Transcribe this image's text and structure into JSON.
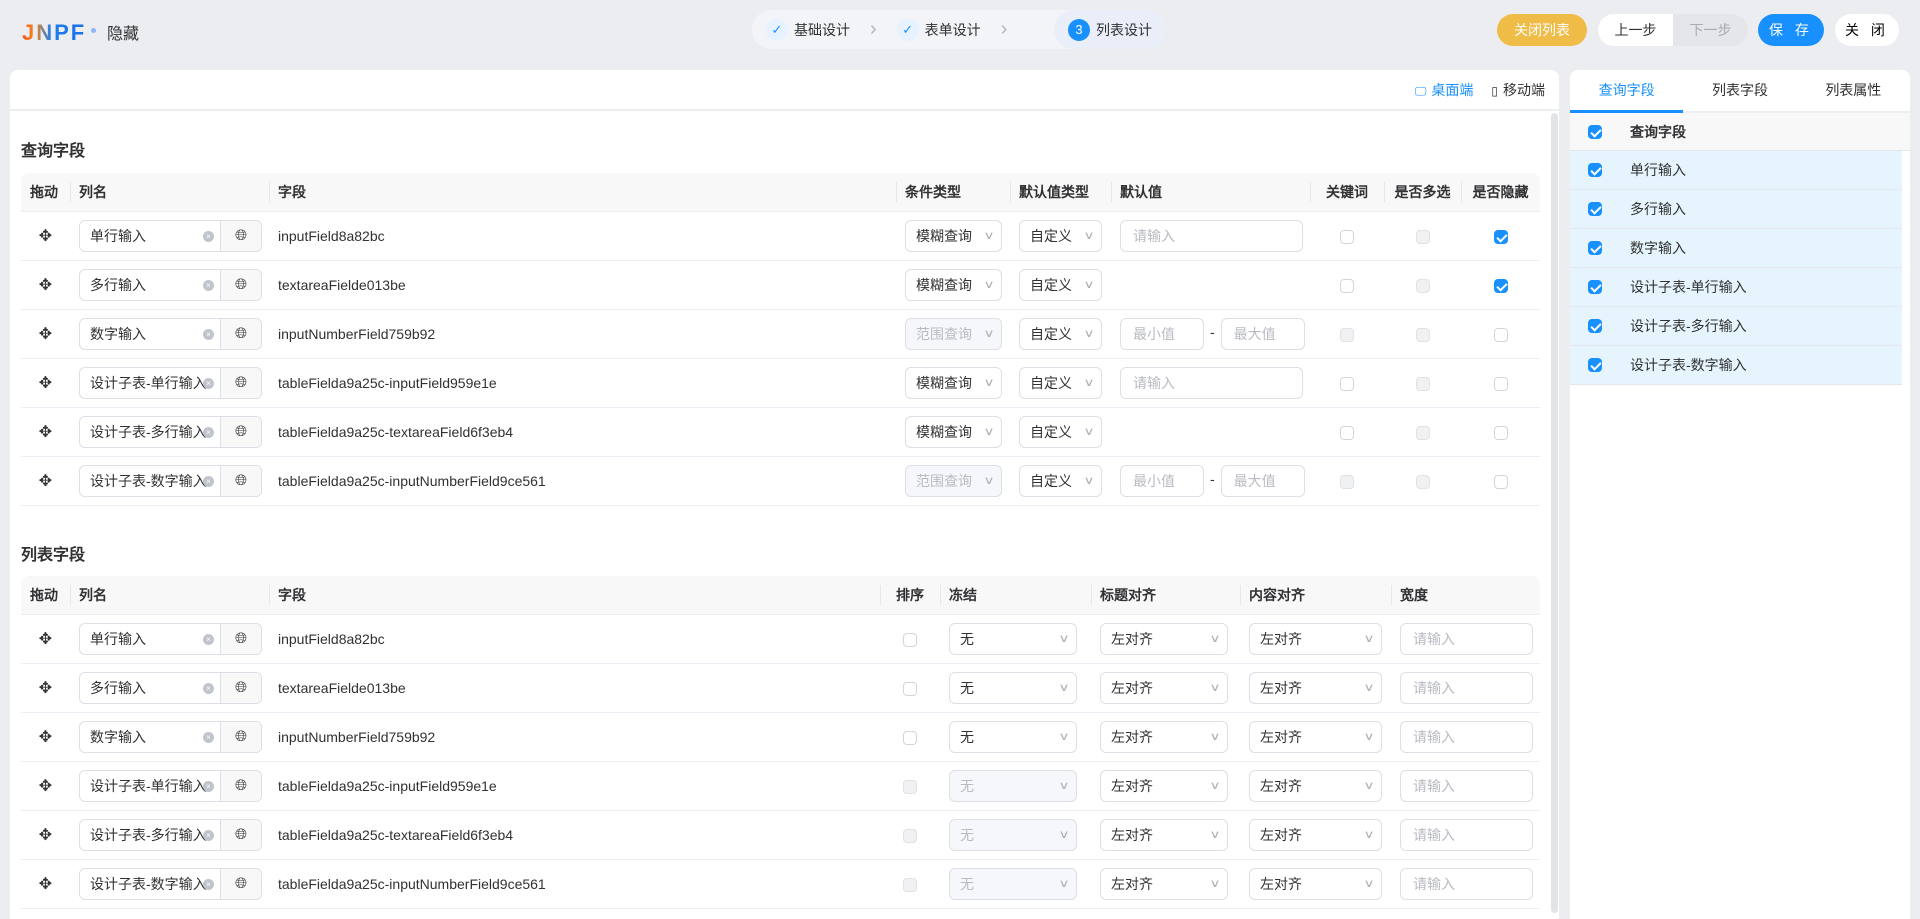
{
  "header": {
    "logo": "JNPF",
    "title": "隐藏",
    "steps": [
      {
        "label": "基础设计",
        "state": "done"
      },
      {
        "label": "表单设计",
        "state": "done"
      },
      {
        "label": "列表设计",
        "state": "current",
        "number": "3"
      }
    ],
    "buttons": {
      "close_list": "关闭列表",
      "prev": "上一步",
      "next": "下一步",
      "save": "保 存",
      "close": "关 闭"
    }
  },
  "toolbar": {
    "desktop": "桌面端",
    "mobile": "移动端"
  },
  "query_fields": {
    "title": "查询字段",
    "columns": [
      "拖动",
      "列名",
      "字段",
      "条件类型",
      "默认值类型",
      "默认值",
      "关键词",
      "是否多选",
      "是否隐藏"
    ],
    "placeholder": "请输入",
    "min_placeholder": "最小值",
    "max_placeholder": "最大值",
    "rows": [
      {
        "name": "单行输入",
        "field": "inputField8a82bc",
        "condition": "模糊查询",
        "condition_disabled": false,
        "default_type": "自定义",
        "default_kind": "input",
        "keyword": "enabled",
        "multi": "disabled",
        "hidden": "checked"
      },
      {
        "name": "多行输入",
        "field": "textareaFielde013be",
        "condition": "模糊查询",
        "condition_disabled": false,
        "default_type": "自定义",
        "default_kind": "none",
        "keyword": "enabled",
        "multi": "disabled",
        "hidden": "checked"
      },
      {
        "name": "数字输入",
        "field": "inputNumberField759b92",
        "condition": "范围查询",
        "condition_disabled": true,
        "default_type": "自定义",
        "default_kind": "range",
        "keyword": "disabled",
        "multi": "disabled",
        "hidden": "enabled"
      },
      {
        "name": "设计子表-单行输入",
        "field": "tableFielda9a25c-inputField959e1e",
        "condition": "模糊查询",
        "condition_disabled": false,
        "default_type": "自定义",
        "default_kind": "input",
        "keyword": "enabled",
        "multi": "disabled",
        "hidden": "enabled"
      },
      {
        "name": "设计子表-多行输入",
        "field": "tableFielda9a25c-textareaField6f3eb4",
        "condition": "模糊查询",
        "condition_disabled": false,
        "default_type": "自定义",
        "default_kind": "none",
        "keyword": "enabled",
        "multi": "disabled",
        "hidden": "enabled"
      },
      {
        "name": "设计子表-数字输入",
        "field": "tableFielda9a25c-inputNumberField9ce561",
        "condition": "范围查询",
        "condition_disabled": true,
        "default_type": "自定义",
        "default_kind": "range",
        "keyword": "disabled",
        "multi": "disabled",
        "hidden": "enabled"
      }
    ]
  },
  "list_fields": {
    "title": "列表字段",
    "columns": [
      "拖动",
      "列名",
      "字段",
      "排序",
      "冻结",
      "标题对齐",
      "内容对齐",
      "宽度"
    ],
    "placeholder": "请输入",
    "rows": [
      {
        "name": "单行输入",
        "field": "inputField8a82bc",
        "sort": "enabled",
        "freeze": "无",
        "freeze_disabled": false,
        "title_align": "左对齐",
        "content_align": "左对齐"
      },
      {
        "name": "多行输入",
        "field": "textareaFielde013be",
        "sort": "enabled",
        "freeze": "无",
        "freeze_disabled": false,
        "title_align": "左对齐",
        "content_align": "左对齐"
      },
      {
        "name": "数字输入",
        "field": "inputNumberField759b92",
        "sort": "enabled",
        "freeze": "无",
        "freeze_disabled": false,
        "title_align": "左对齐",
        "content_align": "左对齐"
      },
      {
        "name": "设计子表-单行输入",
        "field": "tableFielda9a25c-inputField959e1e",
        "sort": "disabled",
        "freeze": "无",
        "freeze_disabled": true,
        "title_align": "左对齐",
        "content_align": "左对齐"
      },
      {
        "name": "设计子表-多行输入",
        "field": "tableFielda9a25c-textareaField6f3eb4",
        "sort": "disabled",
        "freeze": "无",
        "freeze_disabled": true,
        "title_align": "左对齐",
        "content_align": "左对齐"
      },
      {
        "name": "设计子表-数字输入",
        "field": "tableFielda9a25c-inputNumberField9ce561",
        "sort": "disabled",
        "freeze": "无",
        "freeze_disabled": true,
        "title_align": "左对齐",
        "content_align": "左对齐"
      }
    ]
  },
  "side_panel": {
    "tabs": [
      "查询字段",
      "列表字段",
      "列表属性"
    ],
    "active_tab": 0,
    "header": "查询字段",
    "items": [
      "单行输入",
      "多行输入",
      "数字输入",
      "设计子表-单行输入",
      "设计子表-多行输入",
      "设计子表-数字输入"
    ]
  }
}
